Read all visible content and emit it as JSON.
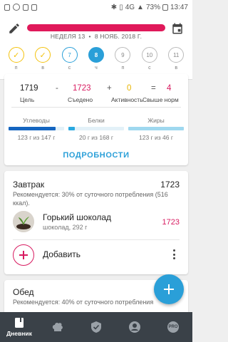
{
  "status_bar": {
    "network": "4G",
    "battery": "73%",
    "time": "13:47"
  },
  "header": {
    "week_label": "НЕДЕЛЯ 13",
    "date_label": "8 НОЯБ. 2018 Г.",
    "separator": "•",
    "date_bar_color": "#e0195a",
    "days": [
      {
        "label": "п",
        "value": "✓",
        "state": "done"
      },
      {
        "label": "в",
        "value": "✓",
        "state": "done"
      },
      {
        "label": "с",
        "value": "7",
        "state": "outline"
      },
      {
        "label": "ч",
        "value": "8",
        "state": "active"
      },
      {
        "label": "п",
        "value": "9",
        "state": "future"
      },
      {
        "label": "с",
        "value": "10",
        "state": "future"
      },
      {
        "label": "в",
        "value": "11",
        "state": "future"
      }
    ]
  },
  "summary": {
    "goal_value": "1719",
    "goal_label": "Цель",
    "minus": "-",
    "eaten_value": "1723",
    "eaten_label": "Съедено",
    "plus": "+",
    "activity_value": "0",
    "activity_label": "Активность",
    "equals": "=",
    "over_value": "4",
    "over_label": "Свыше норм",
    "macros": [
      {
        "name": "Углеводы",
        "value": "123 г из 147 г",
        "fraction": 0.84,
        "color": "#1565c0"
      },
      {
        "name": "Белки",
        "value": "20 г из 168 г",
        "fraction": 0.12,
        "color": "#29a8e0"
      },
      {
        "name": "Жиры",
        "value": "123 г из 46 г",
        "fraction": 1.0,
        "color": "#9fd8ef"
      }
    ],
    "details_label": "ПОДРОБНОСТИ"
  },
  "breakfast": {
    "title": "Завтрак",
    "kcal": "1723",
    "recommendation": "Рекомендуется: 30% от суточного потребления (516 ккал).",
    "item": {
      "name": "Горький шоколад",
      "sub": "шоколад, 292 г",
      "kcal": "1723"
    },
    "add_label": "Добавить"
  },
  "lunch": {
    "title": "Обед",
    "recommendation": "Рекомендуется: 40% от суточного потребления"
  },
  "bottom_nav": [
    {
      "label": "Дневник",
      "icon": "diary-icon",
      "active": true
    },
    {
      "label": "",
      "icon": "chef-hat-icon",
      "active": false
    },
    {
      "label": "",
      "icon": "shield-check-icon",
      "active": false
    },
    {
      "label": "",
      "icon": "profile-icon",
      "active": false
    },
    {
      "label": "PRO",
      "icon": "pro-badge-icon",
      "active": false
    }
  ]
}
